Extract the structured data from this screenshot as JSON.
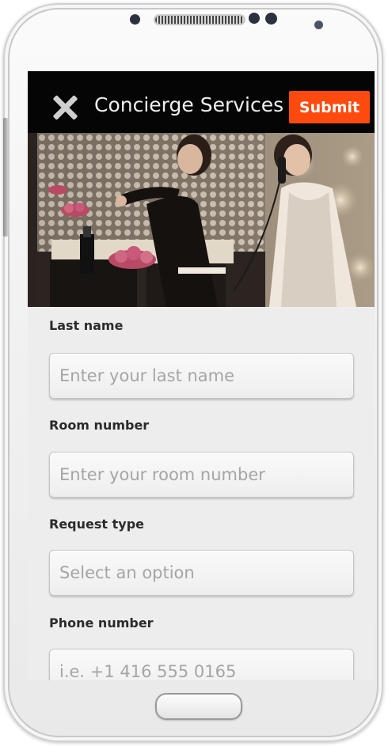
{
  "app": {
    "title": "Concierge Services",
    "submit_label": "Submit"
  },
  "form": {
    "fields": [
      {
        "label": "Last name",
        "placeholder": "Enter your last name"
      },
      {
        "label": "Room number",
        "placeholder": "Enter your room number"
      },
      {
        "label": "Request type",
        "placeholder": "Select an option"
      },
      {
        "label": "Phone number",
        "placeholder": "i.e. +1 416 555 0165"
      }
    ]
  },
  "icons": {
    "close": "close-icon"
  },
  "colors": {
    "accent": "#ff4a0f",
    "appbar": "#050505",
    "form_background": "#ededed"
  }
}
